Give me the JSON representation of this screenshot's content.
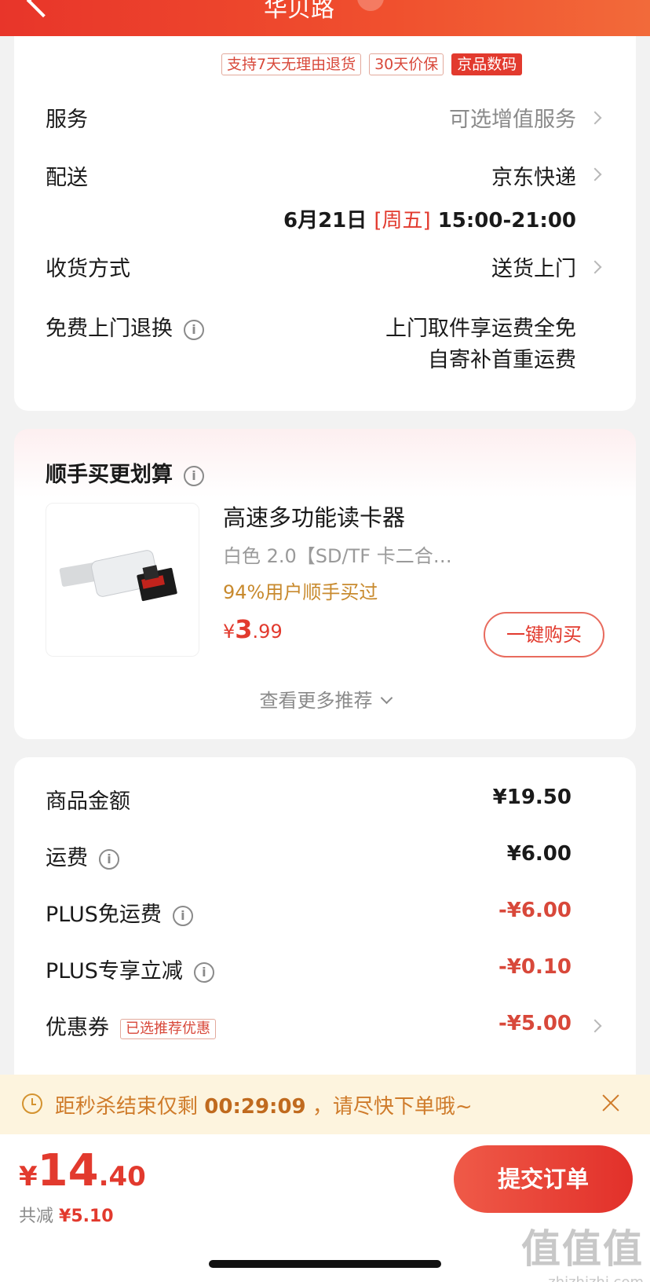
{
  "header": {
    "title": "华贝路"
  },
  "tags": [
    {
      "label": "支持7天无理由退货"
    },
    {
      "label": "30天价保"
    },
    {
      "label": "京品数码"
    }
  ],
  "service": {
    "label": "服务",
    "value": "可选增值服务"
  },
  "delivery": {
    "label": "配送",
    "value": "京东快递",
    "date": "6月21日",
    "weekday": "[周五]",
    "time_window": "15:00-21:00"
  },
  "receive": {
    "label": "收货方式",
    "value": "送货上门"
  },
  "free_return": {
    "label": "免费上门退换",
    "line1": "上门取件享运费全免",
    "line2": "自寄补首重运费"
  },
  "addon": {
    "title": "顺手买更划算",
    "product_name": "高速多功能读卡器",
    "product_spec": "白色 2.0【SD/TF 卡二合…",
    "bought_text": "94%用户顺手买过",
    "price_currency": "¥",
    "price_int": "3",
    "price_dec": ".99",
    "buy_label": "一键购买",
    "more_label": "查看更多推荐"
  },
  "amounts": {
    "goods": {
      "label": "商品金额",
      "value": "¥19.50"
    },
    "shipping": {
      "label": "运费",
      "value": "¥6.00"
    },
    "plus_free_ship": {
      "label": "PLUS免运费",
      "value": "-¥6.00"
    },
    "plus_discount": {
      "label": "PLUS专享立减",
      "value": "-¥0.10"
    },
    "coupon": {
      "label": "优惠券",
      "tag": "已选推荐优惠",
      "value": "-¥5.00"
    }
  },
  "notice": {
    "prefix": "距秒杀结束仅剩",
    "countdown": "00:29:09",
    "suffix": "，请尽快下单哦~"
  },
  "checkout": {
    "currency": "¥",
    "total_int": "14",
    "total_dec": ".40",
    "saved_label": "共减",
    "saved_value": "¥5.10",
    "submit_label": "提交订单"
  },
  "watermark": {
    "big": "值值值",
    "small": "zhizhizhi.com"
  },
  "colors": {
    "accent": "#e23a2e",
    "notice_bg": "#fdf4de",
    "notice_text": "#cf7b2a"
  }
}
